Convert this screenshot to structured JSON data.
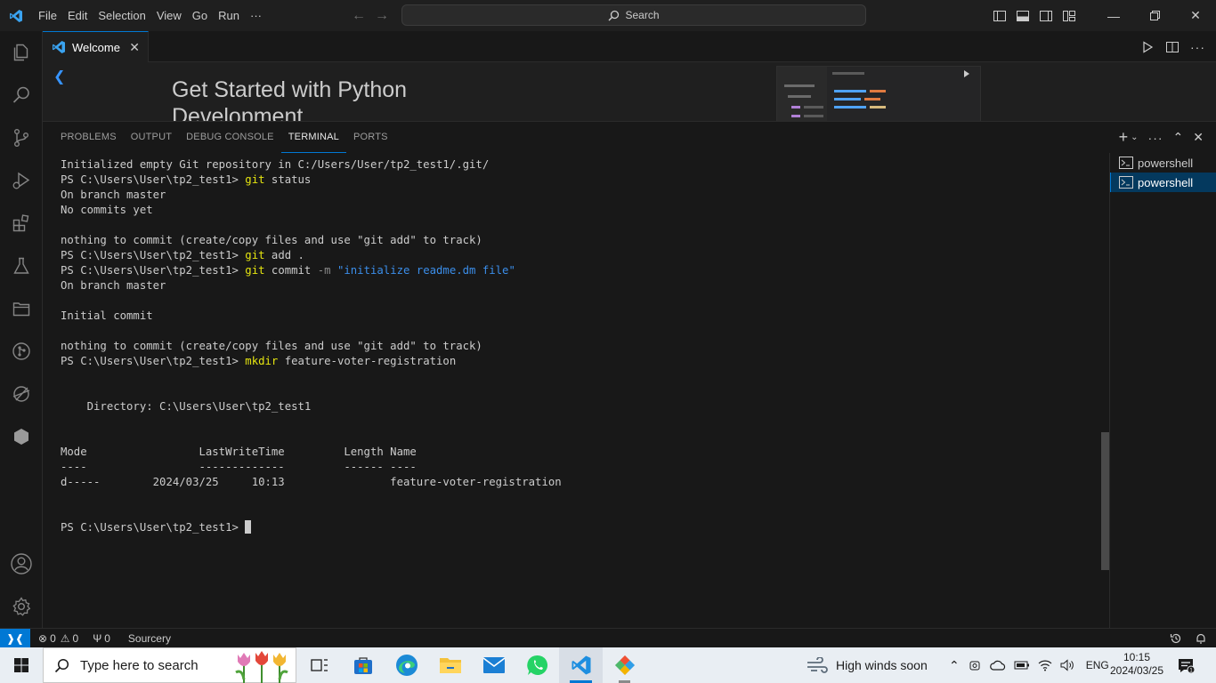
{
  "titlebar": {
    "menu": [
      "File",
      "Edit",
      "Selection",
      "View",
      "Go",
      "Run",
      "···"
    ],
    "search_label": "Search"
  },
  "tabs": [
    {
      "label": "Welcome"
    }
  ],
  "editor": {
    "welcome_title": "Get Started with Python Development"
  },
  "panel": {
    "tabs": [
      "PROBLEMS",
      "OUTPUT",
      "DEBUG CONSOLE",
      "TERMINAL",
      "PORTS"
    ],
    "active_tab": "TERMINAL",
    "terminals": [
      "powershell",
      "powershell"
    ]
  },
  "terminal": {
    "lines": [
      [
        {
          "t": "Initialized empty Git repository in C:/Users/User/tp2_test1/.git/"
        }
      ],
      [
        {
          "t": "PS C:\\Users\\User\\tp2_test1> "
        },
        {
          "t": "git",
          "c": "cmd"
        },
        {
          "t": " status"
        }
      ],
      [
        {
          "t": "On branch master"
        }
      ],
      [
        {
          "t": "No commits yet"
        }
      ],
      [
        {
          "t": ""
        }
      ],
      [
        {
          "t": "nothing to commit (create/copy files and use \"git add\" to track)"
        }
      ],
      [
        {
          "t": "PS C:\\Users\\User\\tp2_test1> "
        },
        {
          "t": "git",
          "c": "cmd"
        },
        {
          "t": " add ."
        }
      ],
      [
        {
          "t": "PS C:\\Users\\User\\tp2_test1> "
        },
        {
          "t": "git",
          "c": "cmd"
        },
        {
          "t": " commit "
        },
        {
          "t": "-m",
          "c": "flag"
        },
        {
          "t": " "
        },
        {
          "t": "\"initialize readme.dm file\"",
          "c": "str"
        }
      ],
      [
        {
          "t": "On branch master"
        }
      ],
      [
        {
          "t": ""
        }
      ],
      [
        {
          "t": "Initial commit"
        }
      ],
      [
        {
          "t": ""
        }
      ],
      [
        {
          "t": "nothing to commit (create/copy files and use \"git add\" to track)"
        }
      ],
      [
        {
          "t": "PS C:\\Users\\User\\tp2_test1> "
        },
        {
          "t": "mkdir",
          "c": "cmd"
        },
        {
          "t": " feature-voter-registration"
        }
      ],
      [
        {
          "t": ""
        }
      ],
      [
        {
          "t": ""
        }
      ],
      [
        {
          "t": "    Directory: C:\\Users\\User\\tp2_test1"
        }
      ],
      [
        {
          "t": ""
        }
      ],
      [
        {
          "t": ""
        }
      ],
      [
        {
          "t": "Mode                 LastWriteTime         Length Name"
        }
      ],
      [
        {
          "t": "----                 -------------         ------ ----"
        }
      ],
      [
        {
          "t": "d-----        2024/03/25     10:13                feature-voter-registration"
        }
      ],
      [
        {
          "t": ""
        }
      ],
      [
        {
          "t": ""
        }
      ],
      [
        {
          "t": "PS C:\\Users\\User\\tp2_test1> "
        },
        {
          "t": "",
          "c": "cursor"
        }
      ]
    ]
  },
  "statusbar": {
    "errors": "0",
    "warnings": "0",
    "ports": "0",
    "extension": "Sourcery"
  },
  "taskbar": {
    "search_placeholder": "Type here to search",
    "weather": "High winds soon",
    "language": "ENG",
    "time": "10:15",
    "date": "2024/03/25"
  },
  "colors": {
    "accent": "#0078d4",
    "command": "#e5e510",
    "string": "#3b8eea"
  }
}
